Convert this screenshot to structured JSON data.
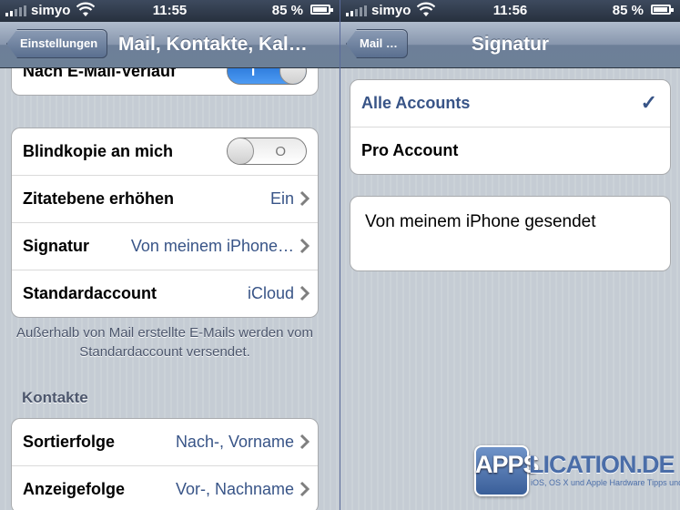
{
  "status_left": {
    "carrier": "simyo",
    "time": "11:55",
    "battery": "85 %"
  },
  "status_right": {
    "carrier": "simyo",
    "time": "11:56",
    "battery": "85 %"
  },
  "left": {
    "back_label": "Einstellungen",
    "title": "Mail, Kontakte, Kal…",
    "thread_row": {
      "label": "Nach E-Mail-Verlauf",
      "toggle_on": true,
      "toggle_mark": "I"
    },
    "rows": [
      {
        "label": "Blindkopie an mich",
        "toggle_on": false,
        "toggle_mark": "O"
      },
      {
        "label": "Zitatebene erhöhen",
        "value": "Ein"
      },
      {
        "label": "Signatur",
        "value": "Von meinem iPhone…"
      },
      {
        "label": "Standardaccount",
        "value": "iCloud"
      }
    ],
    "footnote": "Außerhalb von Mail erstellte E-Mails werden vom Standardaccount versendet.",
    "contacts_header": "Kontakte",
    "contacts_rows": [
      {
        "label": "Sortierfolge",
        "value": "Nach-, Vorname"
      },
      {
        "label": "Anzeigefolge",
        "value": "Vor-, Nachname"
      }
    ]
  },
  "right": {
    "back_label": "Mail …",
    "title": "Signatur",
    "options": [
      {
        "label": "Alle Accounts",
        "selected": true
      },
      {
        "label": "Pro Account",
        "selected": false
      }
    ],
    "checkmark": "✓",
    "signature_text": "Von meinem iPhone gesendet"
  },
  "watermark": {
    "apps": "APPS",
    "rest": "LICATION.DE",
    "tagline": "iOS, OS X und Apple Hardware Tipps und Tests"
  },
  "colors": {
    "accent": "#385487",
    "toggle_on": "#2f7fe4"
  }
}
